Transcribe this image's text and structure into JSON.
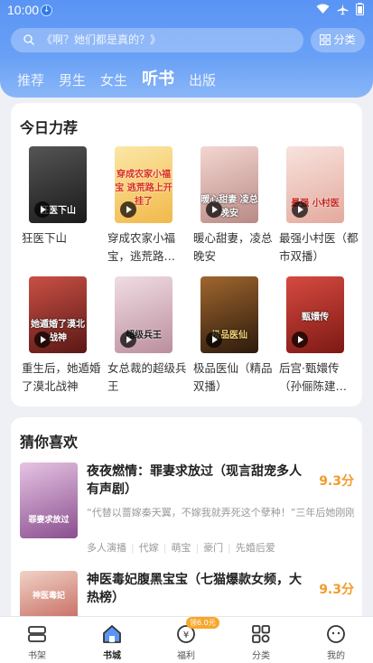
{
  "status": {
    "time": "10:00"
  },
  "search": {
    "placeholder": "《啊？她们都是真的？》"
  },
  "category_button": "分类",
  "tabs": [
    {
      "label": "推荐",
      "active": false
    },
    {
      "label": "男生",
      "active": false
    },
    {
      "label": "女生",
      "active": false
    },
    {
      "label": "听书",
      "active": true
    },
    {
      "label": "出版",
      "active": false
    }
  ],
  "today": {
    "title": "今日力荐",
    "books": [
      {
        "title": "狂医下山",
        "cover_text": "狂医下山",
        "color": "#2a2a2a"
      },
      {
        "title": "穿成农家小福宝，逃荒路…",
        "cover_text": "穿成农家小福宝 逃荒路上开挂了",
        "color": "#f4c95a"
      },
      {
        "title": "暖心甜妻，凌总晚安",
        "cover_text": "暖心甜妻 凌总晚安",
        "color": "#d9a3a3"
      },
      {
        "title": "最强小村医（都市双播）",
        "cover_text": "最强 小村医",
        "color": "#e8b9b0"
      },
      {
        "title": "重生后，她遁婚了漠北战神",
        "cover_text": "她遁婚了漠北战神",
        "color": "#8a2a2a"
      },
      {
        "title": "女总裁的超级兵王",
        "cover_text": "超级兵王",
        "color": "#d8b7c4"
      },
      {
        "title": "极品医仙（精品双播）",
        "cover_text": "极品医仙",
        "color": "#5a3a1e"
      },
      {
        "title": "后宫·甄嬛传（孙俪陈建…",
        "cover_text": "甄嬛传",
        "color": "#b8322c"
      }
    ]
  },
  "guess": {
    "title": "猜你喜欢",
    "items": [
      {
        "title": "夜夜燃情：罪妻求放过（现言甜宠多人有声剧）",
        "score": "9.3分",
        "desc": "“代替以蔷嫁秦天翼，不嫁我就弄死这个孽种！”三年后她刚刚出狱，就被亲生爸妈以宝宝要挟，逼她代替假千金…",
        "tags": [
          "多人演播",
          "代嫁",
          "萌宝",
          "豪门",
          "先婚后爱"
        ],
        "cover_text": "罪妻求放过",
        "color": "#b67ab5"
      },
      {
        "title": "神医毒妃腹黑宝宝（七猫爆款女频，大热榜）",
        "score": "9.3分",
        "desc": "",
        "tags": [],
        "cover_text": "神医毒妃",
        "color": "#c9574d"
      }
    ]
  },
  "nav": [
    {
      "label": "书架",
      "icon": "bookshelf-icon",
      "active": false
    },
    {
      "label": "书城",
      "icon": "bookstore-icon",
      "active": true
    },
    {
      "label": "福利",
      "icon": "welfare-icon",
      "active": false,
      "badge": "领6.0元"
    },
    {
      "label": "分类",
      "icon": "category-icon",
      "active": false
    },
    {
      "label": "我的",
      "icon": "profile-icon",
      "active": false
    }
  ],
  "colors": {
    "accent": "#5a94f4",
    "score": "#f29b2b",
    "badge": "#f7a72b"
  }
}
